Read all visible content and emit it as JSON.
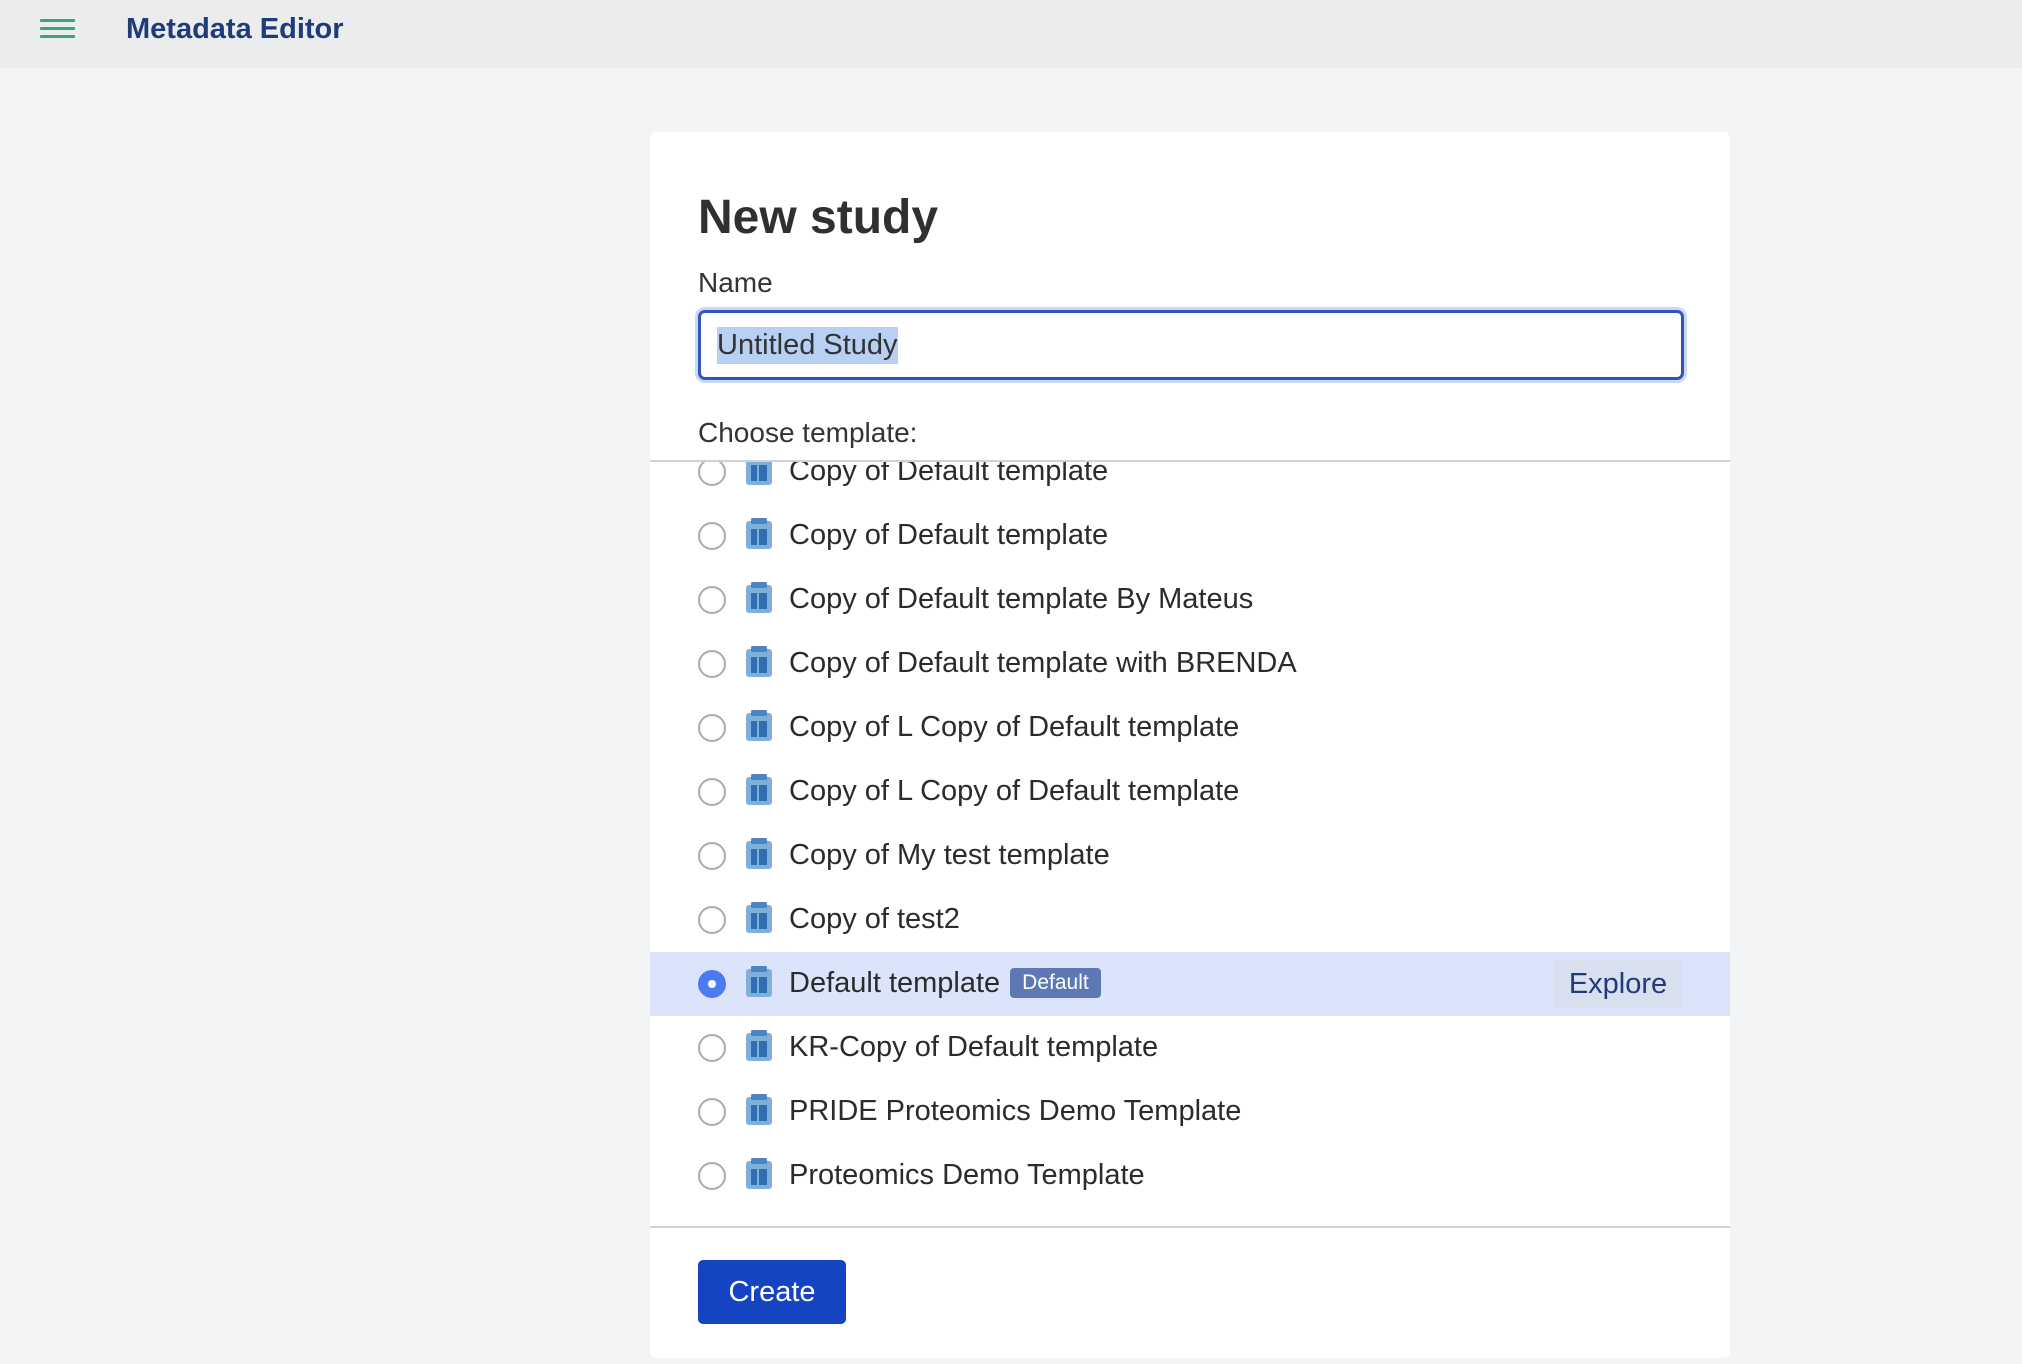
{
  "header": {
    "menu_icon": "hamburger-menu-icon",
    "title": "Metadata Editor"
  },
  "form": {
    "heading": "New study",
    "name_label": "Name",
    "name_value": "Untitled Study",
    "choose_label": "Choose template:",
    "templates": [
      {
        "label": "Copy of Default template",
        "selected": false
      },
      {
        "label": "Copy of Default template",
        "selected": false
      },
      {
        "label": "Copy of Default template By Mateus",
        "selected": false
      },
      {
        "label": "Copy of Default template with BRENDA",
        "selected": false
      },
      {
        "label": "Copy of L Copy of Default template",
        "selected": false
      },
      {
        "label": "Copy of L Copy of Default template",
        "selected": false
      },
      {
        "label": "Copy of My test template",
        "selected": false
      },
      {
        "label": "Copy of test2",
        "selected": false
      },
      {
        "label": "Default template",
        "selected": true,
        "badge": "Default",
        "action": "Explore"
      },
      {
        "label": "KR-Copy of Default template",
        "selected": false
      },
      {
        "label": "PRIDE Proteomics Demo Template",
        "selected": false
      },
      {
        "label": "Proteomics Demo Template",
        "selected": false
      }
    ],
    "template_icon": "clipboard-template-icon",
    "create_label": "Create"
  },
  "colors": {
    "accent": "#1444c2",
    "selected_row": "#dbe4fb",
    "badge": "#5e78b4",
    "menu_icon": "#3aa676",
    "title": "#1f3b78"
  }
}
